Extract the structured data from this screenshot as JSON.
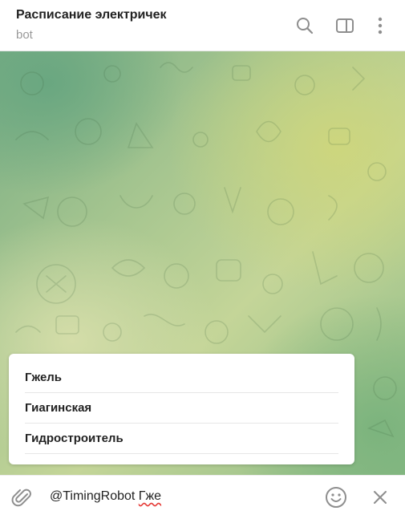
{
  "header": {
    "title": "Расписание электричек",
    "subtitle": "bot",
    "icons": [
      "search-icon",
      "sidebar-toggle-icon",
      "more-vertical-icon"
    ]
  },
  "suggestions": [
    {
      "label": "Гжель"
    },
    {
      "label": "Гиагинская"
    },
    {
      "label": "Гидростроитель"
    }
  ],
  "composer": {
    "text_prefix": "@TimingRobot ",
    "text_query": "Гже",
    "icons": [
      "attach-icon",
      "emoji-icon",
      "close-icon"
    ]
  },
  "colors": {
    "text_primary": "#222222",
    "text_secondary": "#999999",
    "icon_gray": "#8e8e8e",
    "background_green": "#a7c690"
  }
}
